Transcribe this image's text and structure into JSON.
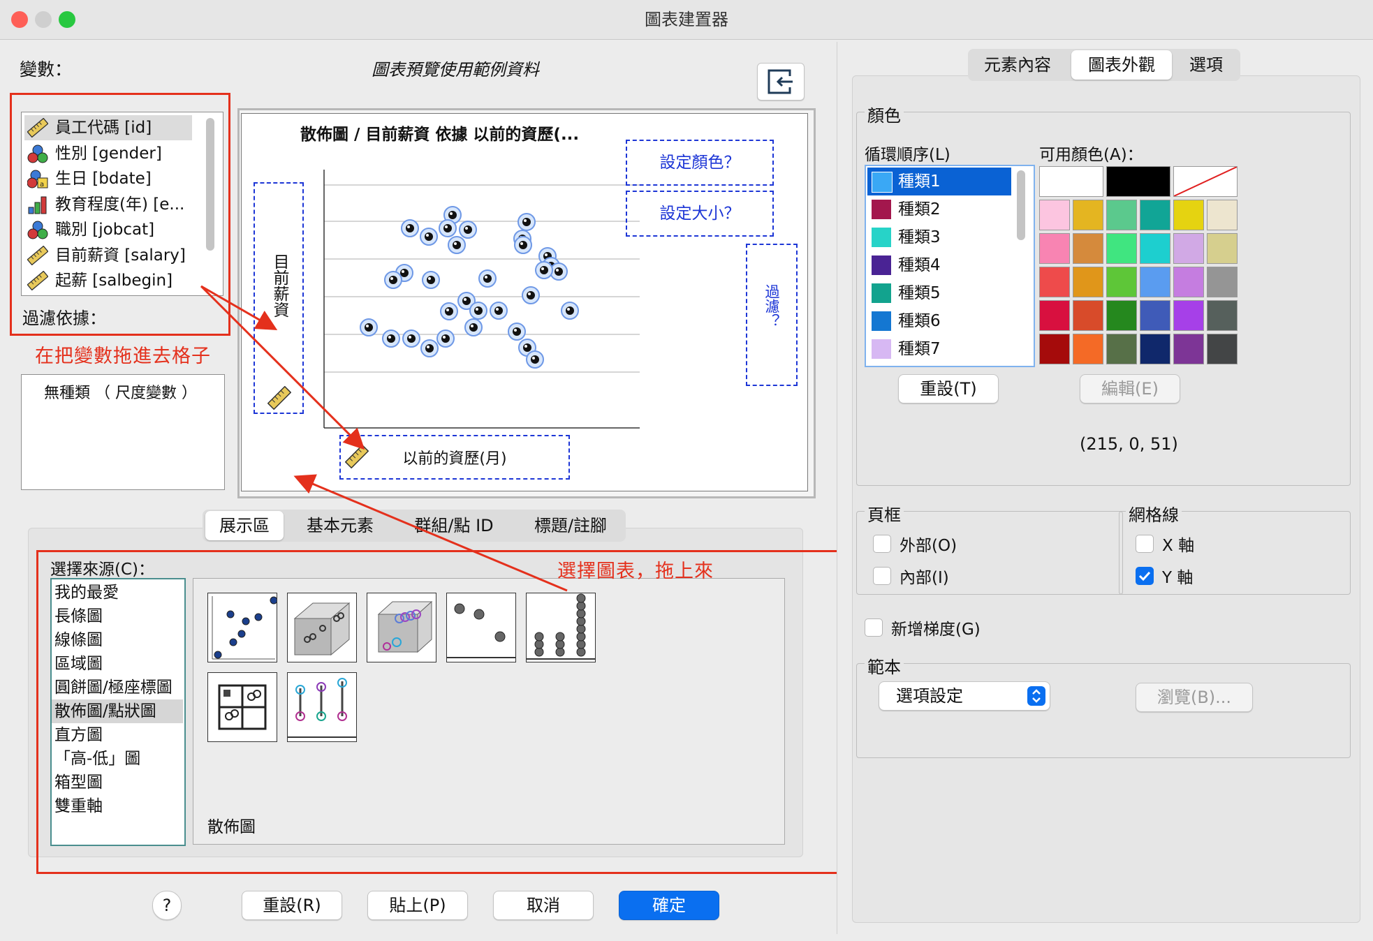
{
  "window": {
    "title": "圖表建置器"
  },
  "left": {
    "variables_label": "變數：",
    "preview_caption": "圖表預覽使用範例資料",
    "variables": [
      {
        "label": "員工代碼   [id]",
        "icon": "ruler-icon"
      },
      {
        "label": "性別 [gender]",
        "icon": "nominal-icon"
      },
      {
        "label": "生日 [bdate]",
        "icon": "date-icon"
      },
      {
        "label": "教育程度(年) [e...",
        "icon": "ordinal-icon"
      },
      {
        "label": "職別 [jobcat]",
        "icon": "nominal-icon"
      },
      {
        "label": "目前薪資 [salary]",
        "icon": "ruler-icon"
      },
      {
        "label": "起薪 [salbegin]",
        "icon": "ruler-icon"
      }
    ],
    "filter_label": "過濾依據：",
    "filter_value": "無種類 （ 尺度變數 ）",
    "annotation_drag": "在把變數拖進去格子",
    "annotation_choose": "選擇圖表，拖上來"
  },
  "preview": {
    "title": "散佈圖 / 目前薪資 依據 以前的資歷(...",
    "y_axis_label": "目前薪資",
    "x_axis_label": "以前的資歷(月)",
    "set_color": "設定顏色？",
    "set_size": "設定大小？",
    "filter_zone": "過濾？"
  },
  "gallery": {
    "tabs": [
      "展示區",
      "基本元素",
      "群組/點 ID",
      "標題/註腳"
    ],
    "selected_tab": "展示區",
    "source_label": "選擇來源(C)：",
    "sources": [
      "我的最愛",
      "長條圖",
      "線條圖",
      "區域圖",
      "圓餅圖/極座標圖",
      "散佈圖/點狀圖",
      "直方圖",
      "「高-低」圖",
      "箱型圖",
      "雙重軸"
    ],
    "selected_source": "散佈圖/點狀圖",
    "thumbnails": [
      "simple-scatter-icon",
      "3d-scatter-icon",
      "grouped-3d-scatter-icon",
      "dot-plot-icon",
      "stacked-dot-icon",
      "scatter-matrix-icon",
      "drop-line-icon"
    ],
    "selected_name": "散佈圖"
  },
  "buttons": {
    "help": "?",
    "reset": "重設(R)",
    "paste": "貼上(P)",
    "cancel": "取消",
    "ok": "確定"
  },
  "right": {
    "tabs": [
      "元素內容",
      "圖表外觀",
      "選項"
    ],
    "selected_tab": "圖表外觀",
    "color_group": "顏色",
    "cycle_label": "循環順序(L)",
    "available_label": "可用顏色(A)：",
    "categories": [
      {
        "label": "種類1",
        "color": "#3aa8f5"
      },
      {
        "label": "種類2",
        "color": "#a3174d"
      },
      {
        "label": "種類3",
        "color": "#27d3c8"
      },
      {
        "label": "種類4",
        "color": "#4a2394"
      },
      {
        "label": "種類5",
        "color": "#12a38e"
      },
      {
        "label": "種類6",
        "color": "#1477d2"
      },
      {
        "label": "種類7",
        "color": "#d7b8f3"
      }
    ],
    "palette": [
      "#ffffff",
      "#000000",
      "none",
      "#fcc5e0",
      "#e4b521",
      "#5bc98d",
      "#11a596",
      "#e5d311",
      "#ede5cf",
      "#f884b2",
      "#d58a3c",
      "#40e580",
      "#1dcfcf",
      "#d1a9e5",
      "#d6cf8e",
      "#ee4b4b",
      "#e0961a",
      "#5ec638",
      "#5a9cf0",
      "#c57de0",
      "#959595",
      "#d8103f",
      "#d84b2a",
      "#25881e",
      "#3f5bb8",
      "#a640e8",
      "#56605c",
      "#a50b0b",
      "#f46a26",
      "#577048",
      "#10286b",
      "#7d3596",
      "#434546"
    ],
    "reset_button": "重設(T)",
    "edit_button": "編輯(E)",
    "rgb_value": "(215, 0, 51)",
    "frame_group": "頁框",
    "frame_outer": "外部(O)",
    "frame_inner": "內部(I)",
    "grid_group": "網格線",
    "grid_x": "X 軸",
    "grid_y": "Y 軸",
    "add_gradient": "新增梯度(G)",
    "template_group": "範本",
    "template_select": "選項設定",
    "browse_button": "瀏覽(B)..."
  }
}
